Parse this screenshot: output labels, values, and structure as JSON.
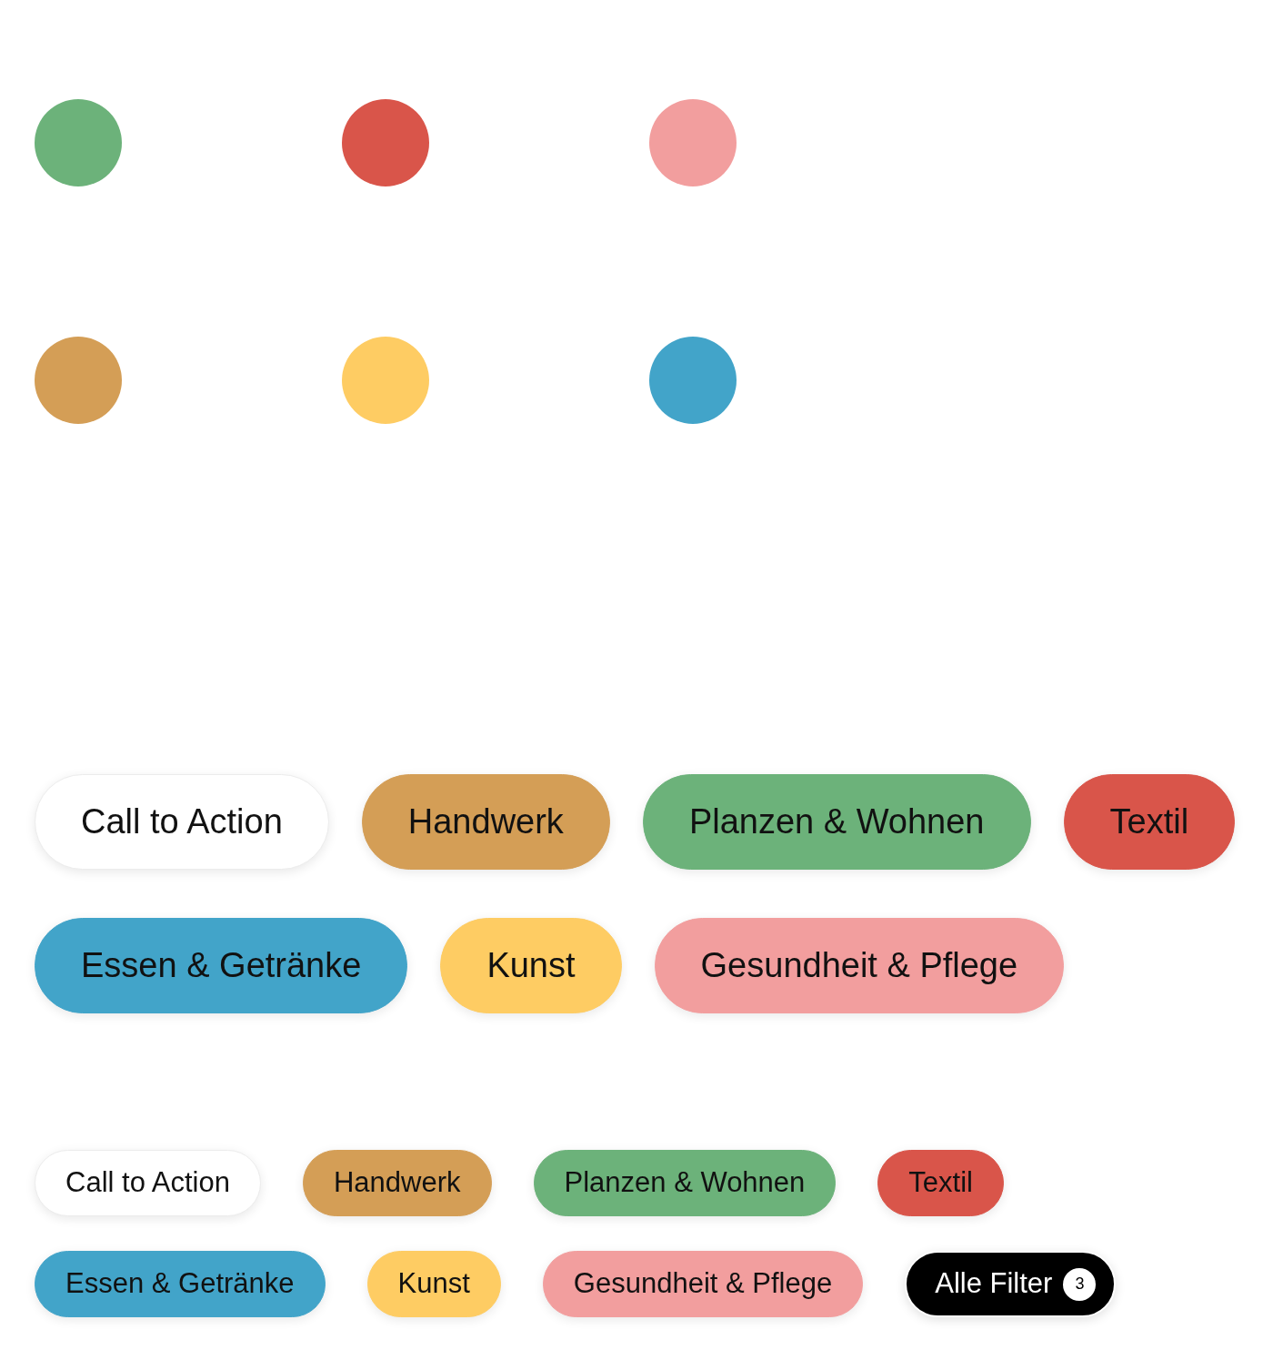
{
  "dots": [
    {
      "color": "#6cb27a"
    },
    {
      "color": "#d9554a"
    },
    {
      "color": "#f29e9e"
    },
    {
      "color": "#d49e56"
    },
    {
      "color": "#fecc63"
    },
    {
      "color": "#42a4c9"
    }
  ],
  "large_tag_rows": [
    [
      {
        "label": "Call to Action",
        "color": "#ffffff"
      },
      {
        "label": "Handwerk",
        "color": "#d49e56"
      },
      {
        "label": "Planzen & Wohnen",
        "color": "#6cb27a"
      },
      {
        "label": "Textil",
        "color": "#d9554a"
      }
    ],
    [
      {
        "label": "Essen & Getränke",
        "color": "#42a4c9"
      },
      {
        "label": "Kunst",
        "color": "#fecc63"
      },
      {
        "label": "Gesundheit & Pflege",
        "color": "#f29e9e"
      }
    ]
  ],
  "small_tag_rows": [
    [
      {
        "label": "Call to Action",
        "color": "#ffffff"
      },
      {
        "label": "Handwerk",
        "color": "#d49e56"
      },
      {
        "label": "Planzen & Wohnen",
        "color": "#6cb27a"
      },
      {
        "label": "Textil",
        "color": "#d9554a"
      }
    ],
    [
      {
        "label": "Essen & Getränke",
        "color": "#42a4c9"
      },
      {
        "label": "Kunst",
        "color": "#fecc63"
      },
      {
        "label": "Gesundheit & Pflege",
        "color": "#f29e9e"
      }
    ]
  ],
  "filter_button": {
    "label": "Alle Filter",
    "count": "3"
  }
}
